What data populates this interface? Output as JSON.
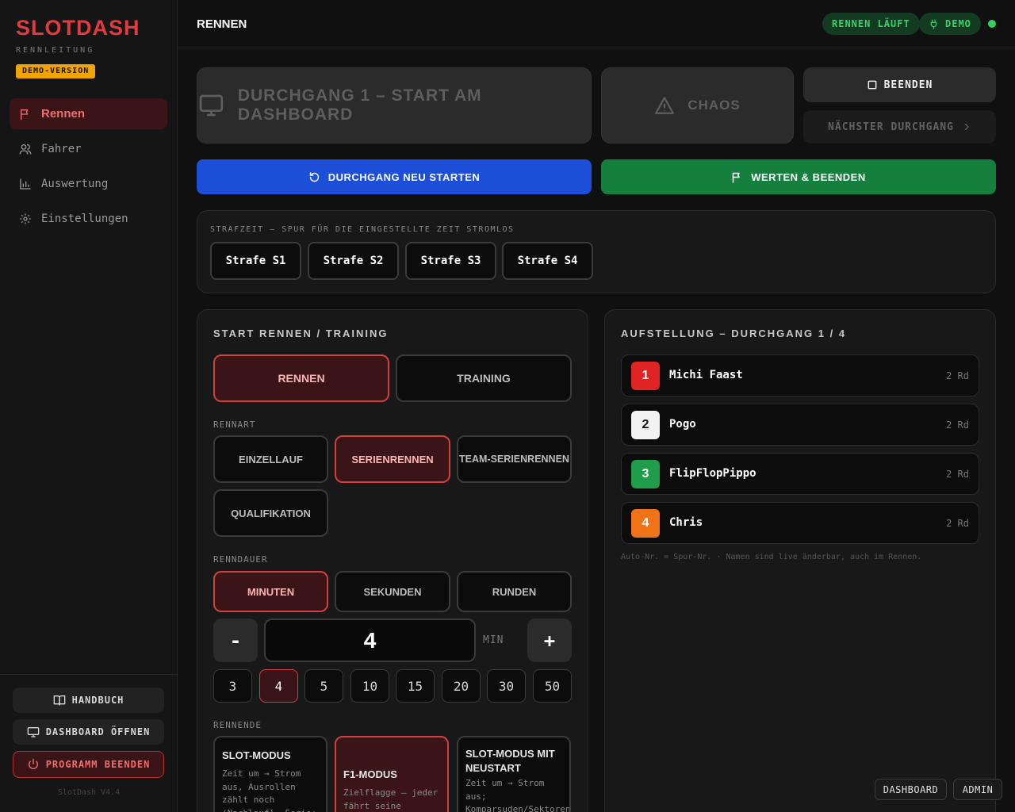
{
  "brand": {
    "name": "SLOTDASH",
    "subtitle": "RENNLEITUNG",
    "badge": "DEMO-VERSION",
    "version": "SlotDash V4.4"
  },
  "nav": [
    {
      "label": "Rennen",
      "icon": "flag-icon",
      "active": true
    },
    {
      "label": "Fahrer",
      "icon": "users-icon",
      "active": false
    },
    {
      "label": "Auswertung",
      "icon": "bar-chart-icon",
      "active": false
    },
    {
      "label": "Einstellungen",
      "icon": "gear-icon",
      "active": false
    }
  ],
  "sidebar_actions": {
    "manual": "HANDBUCH",
    "open_dashboard": "DASHBOARD ÖFFNEN",
    "quit": "PROGRAMM BEENDEN"
  },
  "header": {
    "title": "RENNEN",
    "status": "RENNEN LÄUFT",
    "mode": "DEMO"
  },
  "controls": {
    "start_dashboard": "DURCHGANG 1 – START AM DASHBOARD",
    "chaos": "CHAOS",
    "end": "BEENDEN",
    "next_heat": "NÄCHSTER DURCHGANG",
    "restart": "DURCHGANG NEU STARTEN",
    "score_end": "WERTEN & BEENDEN"
  },
  "penalty": {
    "label": "STRAFZEIT – SPUR FÜR DIE EINGESTELLTE ZEIT STROMLOS",
    "buttons": [
      "Strafe S1",
      "Strafe S2",
      "Strafe S3",
      "Strafe S4"
    ]
  },
  "start": {
    "title": "START RENNEN / TRAINING",
    "types": [
      {
        "label": "RENNEN",
        "selected": true
      },
      {
        "label": "TRAINING",
        "selected": false
      }
    ],
    "race_kind_label": "RENNART",
    "race_kinds": [
      {
        "label": "EINZELLAUF",
        "selected": false
      },
      {
        "label": "SERIENRENNEN",
        "selected": true
      },
      {
        "label": "TEAM-SERIENRENNEN",
        "selected": false
      },
      {
        "label": "QUALIFIKATION",
        "selected": false
      }
    ],
    "duration_label": "RENNDAUER",
    "duration_units": [
      {
        "label": "MINUTEN",
        "selected": true
      },
      {
        "label": "SEKUNDEN",
        "selected": false
      },
      {
        "label": "RUNDEN",
        "selected": false
      }
    ],
    "minus": "-",
    "plus": "+",
    "value": "4",
    "unit": "MIN",
    "presets": [
      {
        "label": "3",
        "selected": false
      },
      {
        "label": "4",
        "selected": true
      },
      {
        "label": "5",
        "selected": false
      },
      {
        "label": "10",
        "selected": false
      },
      {
        "label": "15",
        "selected": false
      },
      {
        "label": "20",
        "selected": false
      },
      {
        "label": "30",
        "selected": false
      },
      {
        "label": "50",
        "selected": false
      }
    ],
    "end_label": "RENNENDE",
    "end_modes": [
      {
        "title": "SLOT-MODUS",
        "desc": "Zeit um → Strom aus, Ausrollen zählt noch (Nachlauf). Serie:",
        "selected": false
      },
      {
        "title": "F1-MODUS",
        "desc": "Zielflagge – jeder fährt seine",
        "selected": true
      },
      {
        "title": "SLOT-MODUS MIT NEUSTART",
        "desc": "Zeit um → Strom aus; Komparsuden/Sektoren",
        "selected": false
      }
    ]
  },
  "lineup": {
    "title": "AUFSTELLUNG – DURCHGANG 1 / 4",
    "drivers": [
      {
        "lane": "1",
        "name": "Michi Faast",
        "laps": "2 Rd",
        "color": "#e02424",
        "text_color": "#ffffff"
      },
      {
        "lane": "2",
        "name": "Pogo",
        "laps": "2 Rd",
        "color": "#f2f2f2",
        "text_color": "#111111"
      },
      {
        "lane": "3",
        "name": "FlipFlopPippo",
        "laps": "2 Rd",
        "color": "#1f9d4a",
        "text_color": "#ffffff"
      },
      {
        "lane": "4",
        "name": "Chris",
        "laps": "2 Rd",
        "color": "#f07318",
        "text_color": "#ffffff"
      }
    ],
    "note": "Auto-Nr. = Spur-Nr. · Namen sind live änderbar, auch im Rennen."
  },
  "footer": {
    "dashboard": "DASHBOARD",
    "admin": "ADMIN"
  },
  "colors": {
    "accent": "#e33b3b",
    "blue": "#1d4ed8",
    "green": "#15803d",
    "status_green": "#2fd15f"
  }
}
